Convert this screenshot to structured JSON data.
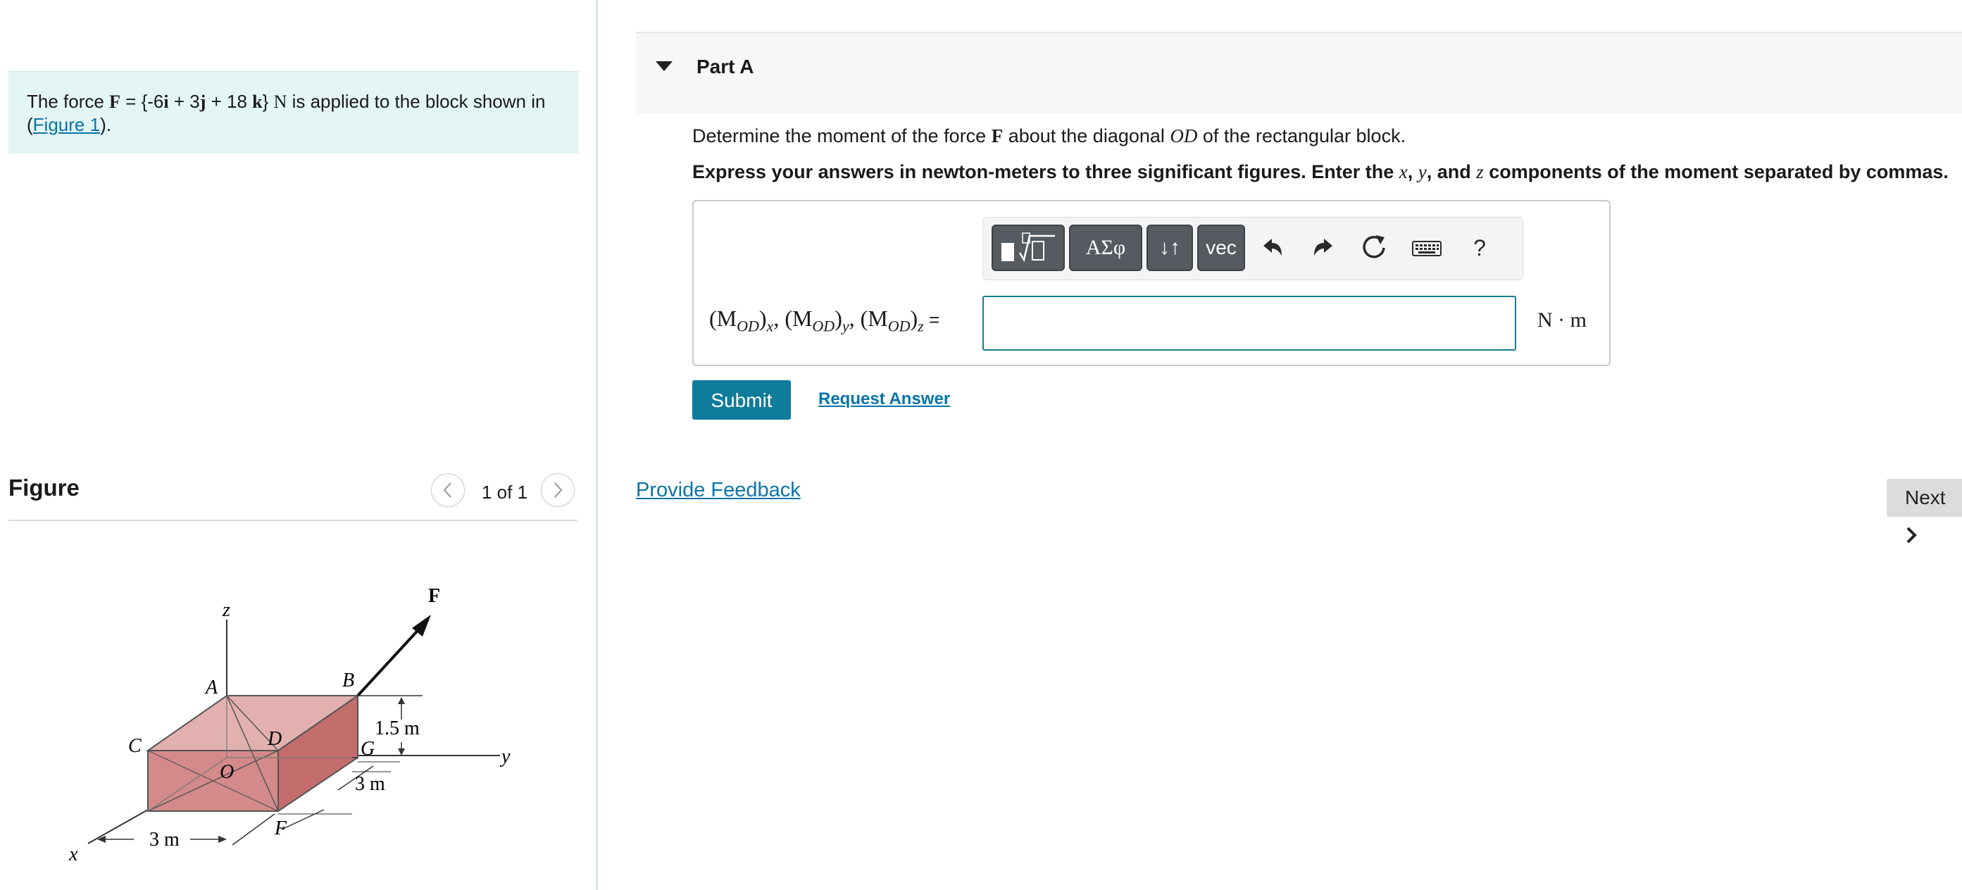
{
  "problem": {
    "prefix": "The force ",
    "force_symbol": "F",
    "equals": " = {-6",
    "i": "i",
    "plus_3": " + 3",
    "j": "j",
    "plus_18": " + 18 ",
    "k": "k",
    "close_brace": "} ",
    "unit_N": "N",
    "suffix": " is applied to the block shown in (",
    "figure_link": "Figure 1",
    "end": ")."
  },
  "figure": {
    "title": "Figure",
    "counter": "1 of 1",
    "prev_icon": "chevron-left-icon",
    "next_icon": "chevron-right-icon",
    "labels": {
      "F": "F",
      "z": "z",
      "A": "A",
      "B": "B",
      "C": "C",
      "D": "D",
      "O": "O",
      "G": "G",
      "F_corner": "F",
      "x": "x",
      "y": "y",
      "height": "1.5 m",
      "depth": "3 m",
      "width": "3 m"
    }
  },
  "part": {
    "title": "Part A",
    "caret_icon": "caret-down-icon",
    "question_prefix": "Determine the moment of the force ",
    "question_F": "F",
    "question_mid": " about the diagonal ",
    "question_OD": "OD",
    "question_suffix": " of the rectangular block.",
    "instruction_1": "Express your answers in newton-meters to three significant figures. Enter the ",
    "instruction_x": "x",
    "instruction_c1": ", ",
    "instruction_y": "y",
    "instruction_c2": ", and ",
    "instruction_z": "z",
    "instruction_2": " components of the moment separated by commas."
  },
  "toolbar": {
    "templates_icon": "templates-icon",
    "greek_label": "ΑΣφ",
    "arrows_label": "↓↑",
    "vec_label": "vec",
    "undo_icon": "undo-icon",
    "redo_icon": "redo-icon",
    "reset_icon": "reset-icon",
    "keyboard_icon": "keyboard-icon",
    "help_label": "?"
  },
  "answer": {
    "lhs_1": "(M",
    "lhs_sub1": "OD",
    "lhs_x": "x",
    "lhs_2": ", (M",
    "lhs_sub2": "OD",
    "lhs_y": "y",
    "lhs_3": ", (M",
    "lhs_sub3": "OD",
    "lhs_z": "z",
    "lhs_eq": " =",
    "input_value": "",
    "unit": "N · m"
  },
  "actions": {
    "submit": "Submit",
    "request_answer": "Request Answer",
    "provide_feedback": "Provide Feedback",
    "next": "Next"
  },
  "colors": {
    "accent": "#0e7c9a",
    "link": "#0a74a8",
    "problem_bg": "#e4f5f5",
    "block_top": "#e3b0b0",
    "block_side": "#c46d6d",
    "block_front": "#d48a8a"
  }
}
